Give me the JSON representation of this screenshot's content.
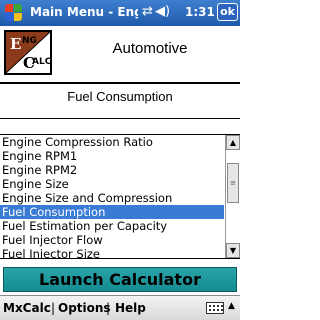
{
  "titlebar": {
    "title": "Main Menu - EngCa",
    "time": "1:31",
    "ok_label": "ok",
    "icons": [
      "windows-logo-icon",
      "connectivity-icon",
      "volume-icon"
    ]
  },
  "header": {
    "logo_text_top": "NG",
    "logo_text_bottom": "ALC",
    "app_name": "Automotive"
  },
  "section": {
    "title": "Fuel Consumption"
  },
  "list": {
    "items": [
      "Engine Compression Ratio",
      "Engine RPM1",
      "Engine RPM2",
      "Engine Size",
      "Engine Size and Compression",
      "Fuel Consumption",
      "Fuel Estimation per Capacity",
      "Fuel Injector Flow",
      "Fuel Injector Size"
    ],
    "selected_index": 5
  },
  "launch_button": {
    "label": "Launch Calculator",
    "color": "#1f9aa0"
  },
  "menubar": {
    "items": [
      "MxCalc",
      "Options",
      "Help"
    ],
    "separator": "|"
  },
  "colors": {
    "titlebar": "#2f6fc4",
    "selection": "#3a7bd5"
  }
}
